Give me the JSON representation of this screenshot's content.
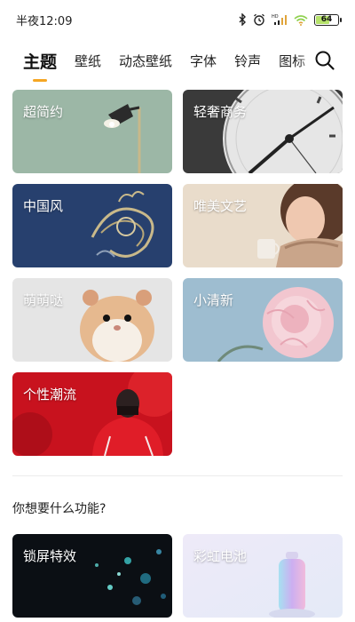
{
  "status_bar": {
    "time": "半夜12:09",
    "battery": "64",
    "battery_level": 0.64,
    "icons": [
      "bluetooth-icon",
      "alarm-icon",
      "hd-signal-icon",
      "wifi-icon",
      "battery-icon"
    ]
  },
  "tabs": [
    {
      "label": "主题",
      "active": true
    },
    {
      "label": "壁纸",
      "active": false
    },
    {
      "label": "动态壁纸",
      "active": false
    },
    {
      "label": "字体",
      "active": false
    },
    {
      "label": "铃声",
      "active": false
    },
    {
      "label": "图标",
      "active": false
    }
  ],
  "search": {
    "icon": "search-icon"
  },
  "colors": {
    "accent": "#f5a623"
  },
  "categories": [
    {
      "label": "超简约"
    },
    {
      "label": "轻奢商务"
    },
    {
      "label": "中国风"
    },
    {
      "label": "唯美文艺"
    },
    {
      "label": "萌萌哒"
    },
    {
      "label": "小清新"
    },
    {
      "label": "个性潮流"
    }
  ],
  "features_section": {
    "title": "你想要什么功能?",
    "items": [
      {
        "label": "锁屏特效"
      },
      {
        "label": "彩虹电池"
      }
    ]
  }
}
